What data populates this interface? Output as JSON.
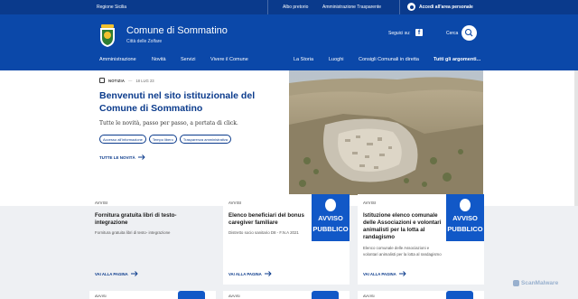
{
  "slim_header": {
    "region": "Regione Sicilia",
    "links": [
      "Albo pretorio",
      "Amministrazione Trasparente"
    ],
    "login": "Accedi all'area personale"
  },
  "brand": {
    "title": "Comune di Sommatino",
    "subtitle": "Città delle Zolfare"
  },
  "social": {
    "label": "Seguici su:",
    "icon": "facebook-icon"
  },
  "search": {
    "label": "Cerca",
    "icon": "search-icon"
  },
  "nav": {
    "main": [
      "Amministrazione",
      "Novità",
      "Servizi",
      "Vivere il Comune"
    ],
    "secondary": [
      "La Storia",
      "Luoghi",
      "Consigli Comunali in diretta"
    ],
    "all": "Tutti gli argomenti..."
  },
  "hero": {
    "kind": "NOTIZIA",
    "date": "18 LUG 23",
    "title": "Benvenuti nel sito istituzionale del Comune di Sommatino",
    "description": "Tutte le novità, passo per passo, a portata di click.",
    "tags": [
      "Accesso all'informazione",
      "Tempo libero",
      "Trasparenza amministrativa"
    ],
    "all_news": "TUTTE LE NOVITÀ",
    "photo_alt": "Veduta aerea di Sommatino"
  },
  "cards": [
    {
      "kind": "AVVISI",
      "title": "Fornitura gratuita libri di testo-integrazione",
      "description": "Fornitura gratuita libri di testo- integrazione",
      "more": "VAI ALLA PAGINA",
      "badge": null
    },
    {
      "kind": "AVVISI",
      "title": "Elenco beneficiari del bonus caregiver familiare",
      "description": "Distretto socio sanitario D8 - F.N.A 2021",
      "more": "VAI ALLA PAGINA",
      "badge": [
        "AVVISO",
        "PUBBLICO"
      ]
    },
    {
      "kind": "AVVISI",
      "title": "Istituzione elenco comunale delle Associazioni e volontari animalisti per la lotta al randagismo",
      "description": "Elenco comunale delle Associazioni e volontari animalisti per la lotta al randagismo",
      "more": "VAI ALLA PAGINA",
      "badge": [
        "AVVISO",
        "PUBBLICO"
      ]
    }
  ],
  "peek_cards": [
    "AVVISI",
    "AVVISI",
    "AVVISI"
  ],
  "watermark": "ScanMalware",
  "colors": {
    "slim_bg": "#0a3a8c",
    "header_bg": "#0b48a9",
    "primary_text": "#0b3b8c",
    "badge_bg": "#1158c7",
    "band_bg": "#eef0f3"
  }
}
